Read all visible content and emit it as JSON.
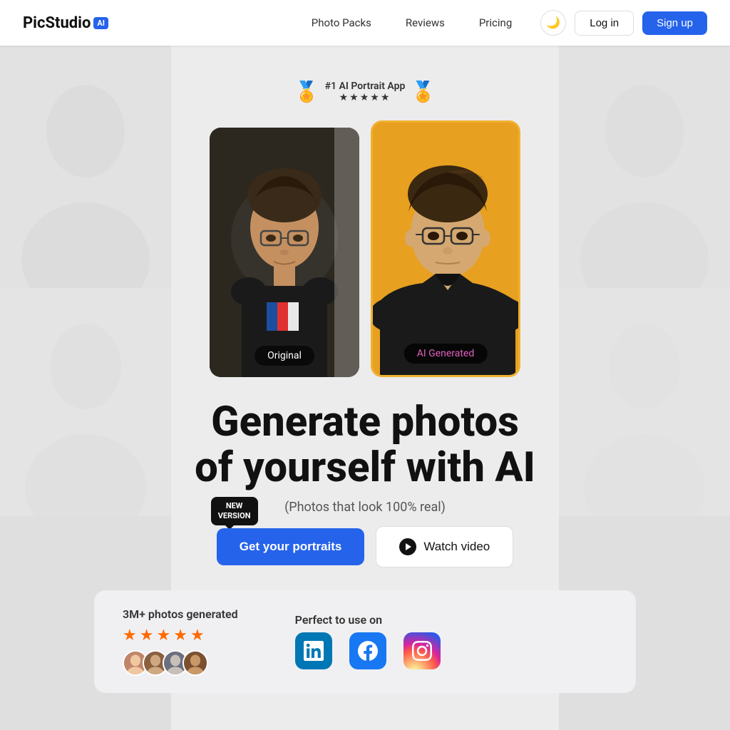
{
  "nav": {
    "logo_text": "PicStudio",
    "logo_badge": "AI",
    "links": [
      {
        "id": "photo-packs",
        "label": "Photo Packs"
      },
      {
        "id": "reviews",
        "label": "Reviews"
      },
      {
        "id": "pricing",
        "label": "Pricing"
      }
    ],
    "theme_toggle_icon": "🌙",
    "login_label": "Log in",
    "signup_label": "Sign up"
  },
  "hero": {
    "award_title": "#1 AI Portrait App",
    "award_stars": "★★★★★",
    "photo_original_label": "Original",
    "photo_ai_label": "AI Generated",
    "heading_line1": "Generate photos",
    "heading_line2": "of yourself with AI",
    "subheading": "(Photos that look 100% real)",
    "new_version_badge_line1": "NEW",
    "new_version_badge_line2": "VERSION",
    "btn_portraits_label": "Get your portraits",
    "btn_watch_label": "Watch video"
  },
  "social_proof": {
    "photos_label": "3M+ photos generated",
    "stars": [
      "★",
      "★",
      "★",
      "★",
      "★"
    ],
    "platform_label": "Perfect to use on",
    "platforms": [
      {
        "id": "linkedin",
        "icon": "in",
        "name": "LinkedIn"
      },
      {
        "id": "facebook",
        "icon": "f",
        "name": "Facebook"
      },
      {
        "id": "instagram",
        "icon": "📷",
        "name": "Instagram"
      }
    ]
  }
}
